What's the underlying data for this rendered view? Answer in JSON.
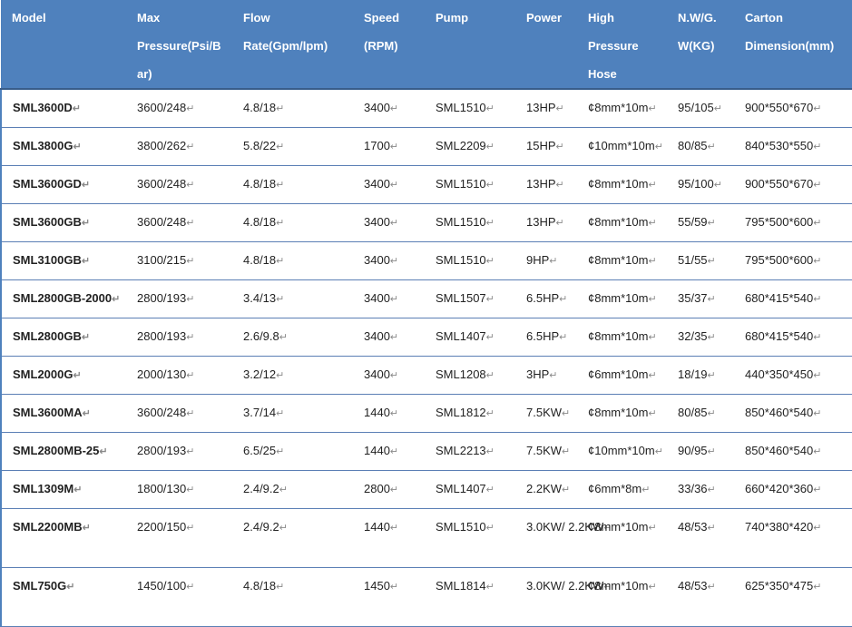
{
  "table": {
    "headers": [
      "Model",
      "Max Pressure(Psi/B ar)",
      "Flow Rate(Gpm/lpm)",
      "Speed (RPM)",
      "Pump",
      "Power",
      "High Pressure Hose",
      "N.W/G. W(KG)",
      "Carton Dimension(mm)"
    ],
    "rows": [
      [
        "SML3600D",
        "3600/248",
        "4.8/18",
        "3400",
        "SML1510",
        "13HP",
        "¢8mm*10m",
        "95/105",
        "900*550*670"
      ],
      [
        "SML3800G",
        "3800/262",
        "5.8/22",
        "1700",
        "SML2209",
        "15HP",
        "¢10mm*10m",
        "80/85",
        "840*530*550"
      ],
      [
        "SML3600GD",
        "3600/248",
        "4.8/18",
        "3400",
        "SML1510",
        "13HP",
        "¢8mm*10m",
        "95/100",
        "900*550*670"
      ],
      [
        "SML3600GB",
        "3600/248",
        "4.8/18",
        "3400",
        "SML1510",
        "13HP",
        "¢8mm*10m",
        "55/59",
        "795*500*600"
      ],
      [
        "SML3100GB",
        "3100/215",
        "4.8/18",
        "3400",
        "SML1510",
        "9HP",
        "¢8mm*10m",
        "51/55",
        "795*500*600"
      ],
      [
        "SML2800GB-2000",
        "2800/193",
        "3.4/13",
        "3400",
        "SML1507",
        "6.5HP",
        "¢8mm*10m",
        "35/37",
        "680*415*540"
      ],
      [
        "SML2800GB",
        "2800/193",
        "2.6/9.8",
        "3400",
        "SML1407",
        "6.5HP",
        "¢8mm*10m",
        "32/35",
        "680*415*540"
      ],
      [
        "SML2000G",
        "2000/130",
        "3.2/12",
        "3400",
        "SML1208",
        "3HP",
        "¢6mm*10m",
        "18/19",
        "440*350*450"
      ],
      [
        "SML3600MA",
        "3600/248",
        "3.7/14",
        "1440",
        "SML1812",
        "7.5KW",
        "¢8mm*10m",
        "80/85",
        "850*460*540"
      ],
      [
        "SML2800MB-25",
        "2800/193",
        "6.5/25",
        "1440",
        "SML2213",
        "7.5KW",
        "¢10mm*10m",
        "90/95",
        "850*460*540"
      ],
      [
        "SML1309M",
        "1800/130",
        "2.4/9.2",
        "2800",
        "SML1407",
        "2.2KW",
        "¢6mm*8m",
        "33/36",
        "660*420*360"
      ],
      [
        "SML2200MB",
        "2200/150",
        "2.4/9.2",
        "1440",
        "SML1510",
        "3.0KW/ 2.2KW",
        "¢8mm*10m",
        "48/53",
        "740*380*420"
      ],
      [
        "SML750G",
        "1450/100",
        "4.8/18",
        "1450",
        "SML1814",
        "3.0KW/ 2.2KW",
        "¢8mm*10m",
        "48/53",
        "625*350*475"
      ]
    ],
    "cell_mark": "↵",
    "colors": {
      "header_bg": "#4f81bd",
      "header_text": "#ffffff",
      "border": "#5b7fb5"
    }
  }
}
